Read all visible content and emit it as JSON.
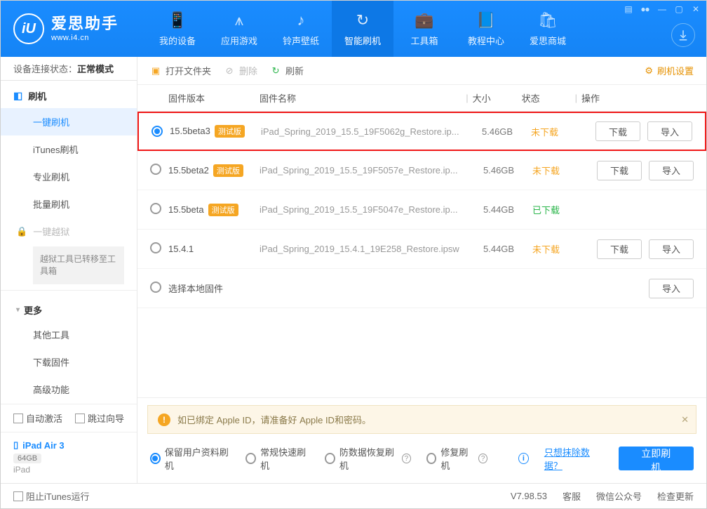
{
  "window": {
    "app_name_cn": "爱思助手",
    "app_url": "www.i4.cn",
    "logo_letter": "iU"
  },
  "topnav": {
    "items": [
      {
        "icon": "📱",
        "label": "我的设备"
      },
      {
        "icon": "⩚",
        "label": "应用游戏"
      },
      {
        "icon": "♪",
        "label": "铃声壁纸"
      },
      {
        "icon": "↻",
        "label": "智能刷机"
      },
      {
        "icon": "💼",
        "label": "工具箱"
      },
      {
        "icon": "📘",
        "label": "教程中心"
      },
      {
        "icon": "🛍",
        "label": "爱思商城"
      }
    ],
    "active_index": 3
  },
  "status": {
    "label": "设备连接状态：",
    "value": "正常模式"
  },
  "toolbar": {
    "open": "打开文件夹",
    "delete": "删除",
    "refresh": "刷新",
    "settings": "刷机设置"
  },
  "table": {
    "headers": {
      "ver": "固件版本",
      "name": "固件名称",
      "size": "大小",
      "status": "状态",
      "act": "操作"
    },
    "download_btn": "下载",
    "import_btn": "导入",
    "rows": [
      {
        "selected": true,
        "highlight": true,
        "ver": "15.5beta3",
        "beta": "测试版",
        "name": "iPad_Spring_2019_15.5_19F5062g_Restore.ip...",
        "size": "5.46GB",
        "status": "未下载",
        "status_ok": false,
        "dl": true,
        "imp": true
      },
      {
        "selected": false,
        "ver": "15.5beta2",
        "beta": "测试版",
        "name": "iPad_Spring_2019_15.5_19F5057e_Restore.ip...",
        "size": "5.46GB",
        "status": "未下载",
        "status_ok": false,
        "dl": true,
        "imp": true
      },
      {
        "selected": false,
        "ver": "15.5beta",
        "beta": "测试版",
        "name": "iPad_Spring_2019_15.5_19F5047e_Restore.ip...",
        "size": "5.44GB",
        "status": "已下载",
        "status_ok": true,
        "dl": false,
        "imp": false
      },
      {
        "selected": false,
        "ver": "15.4.1",
        "beta": "",
        "name": "iPad_Spring_2019_15.4.1_19E258_Restore.ipsw",
        "size": "5.44GB",
        "status": "未下载",
        "status_ok": false,
        "dl": true,
        "imp": true
      },
      {
        "selected": false,
        "ver": "选择本地固件",
        "beta": "",
        "name": "",
        "size": "",
        "status": "",
        "status_ok": false,
        "dl": false,
        "imp": true
      }
    ]
  },
  "sidebar": {
    "flash_head": "刷机",
    "items": [
      "一键刷机",
      "iTunes刷机",
      "专业刷机",
      "批量刷机"
    ],
    "active_index": 0,
    "jailbreak": "一键越狱",
    "jailbreak_note": "越狱工具已转移至工具箱",
    "more_head": "更多",
    "more_items": [
      "其他工具",
      "下载固件",
      "高级功能"
    ],
    "auto_activate": "自动激活",
    "skip_guide": "跳过向导"
  },
  "device": {
    "name": "iPad Air 3",
    "capacity": "64GB",
    "type": "iPad"
  },
  "alert": {
    "text": "如已绑定 Apple ID，请准备好 Apple ID和密码。"
  },
  "modes": {
    "items": [
      {
        "label": "保留用户资料刷机",
        "selected": true,
        "help": false
      },
      {
        "label": "常规快速刷机",
        "selected": false,
        "help": false
      },
      {
        "label": "防数据恢复刷机",
        "selected": false,
        "help": true
      },
      {
        "label": "修复刷机",
        "selected": false,
        "help": true
      }
    ],
    "info_link": "只想抹除数据？",
    "go_btn": "立即刷机"
  },
  "footer": {
    "block_itunes": "阻止iTunes运行",
    "version": "V7.98.53",
    "support": "客服",
    "wechat": "微信公众号",
    "check_update": "检查更新"
  }
}
